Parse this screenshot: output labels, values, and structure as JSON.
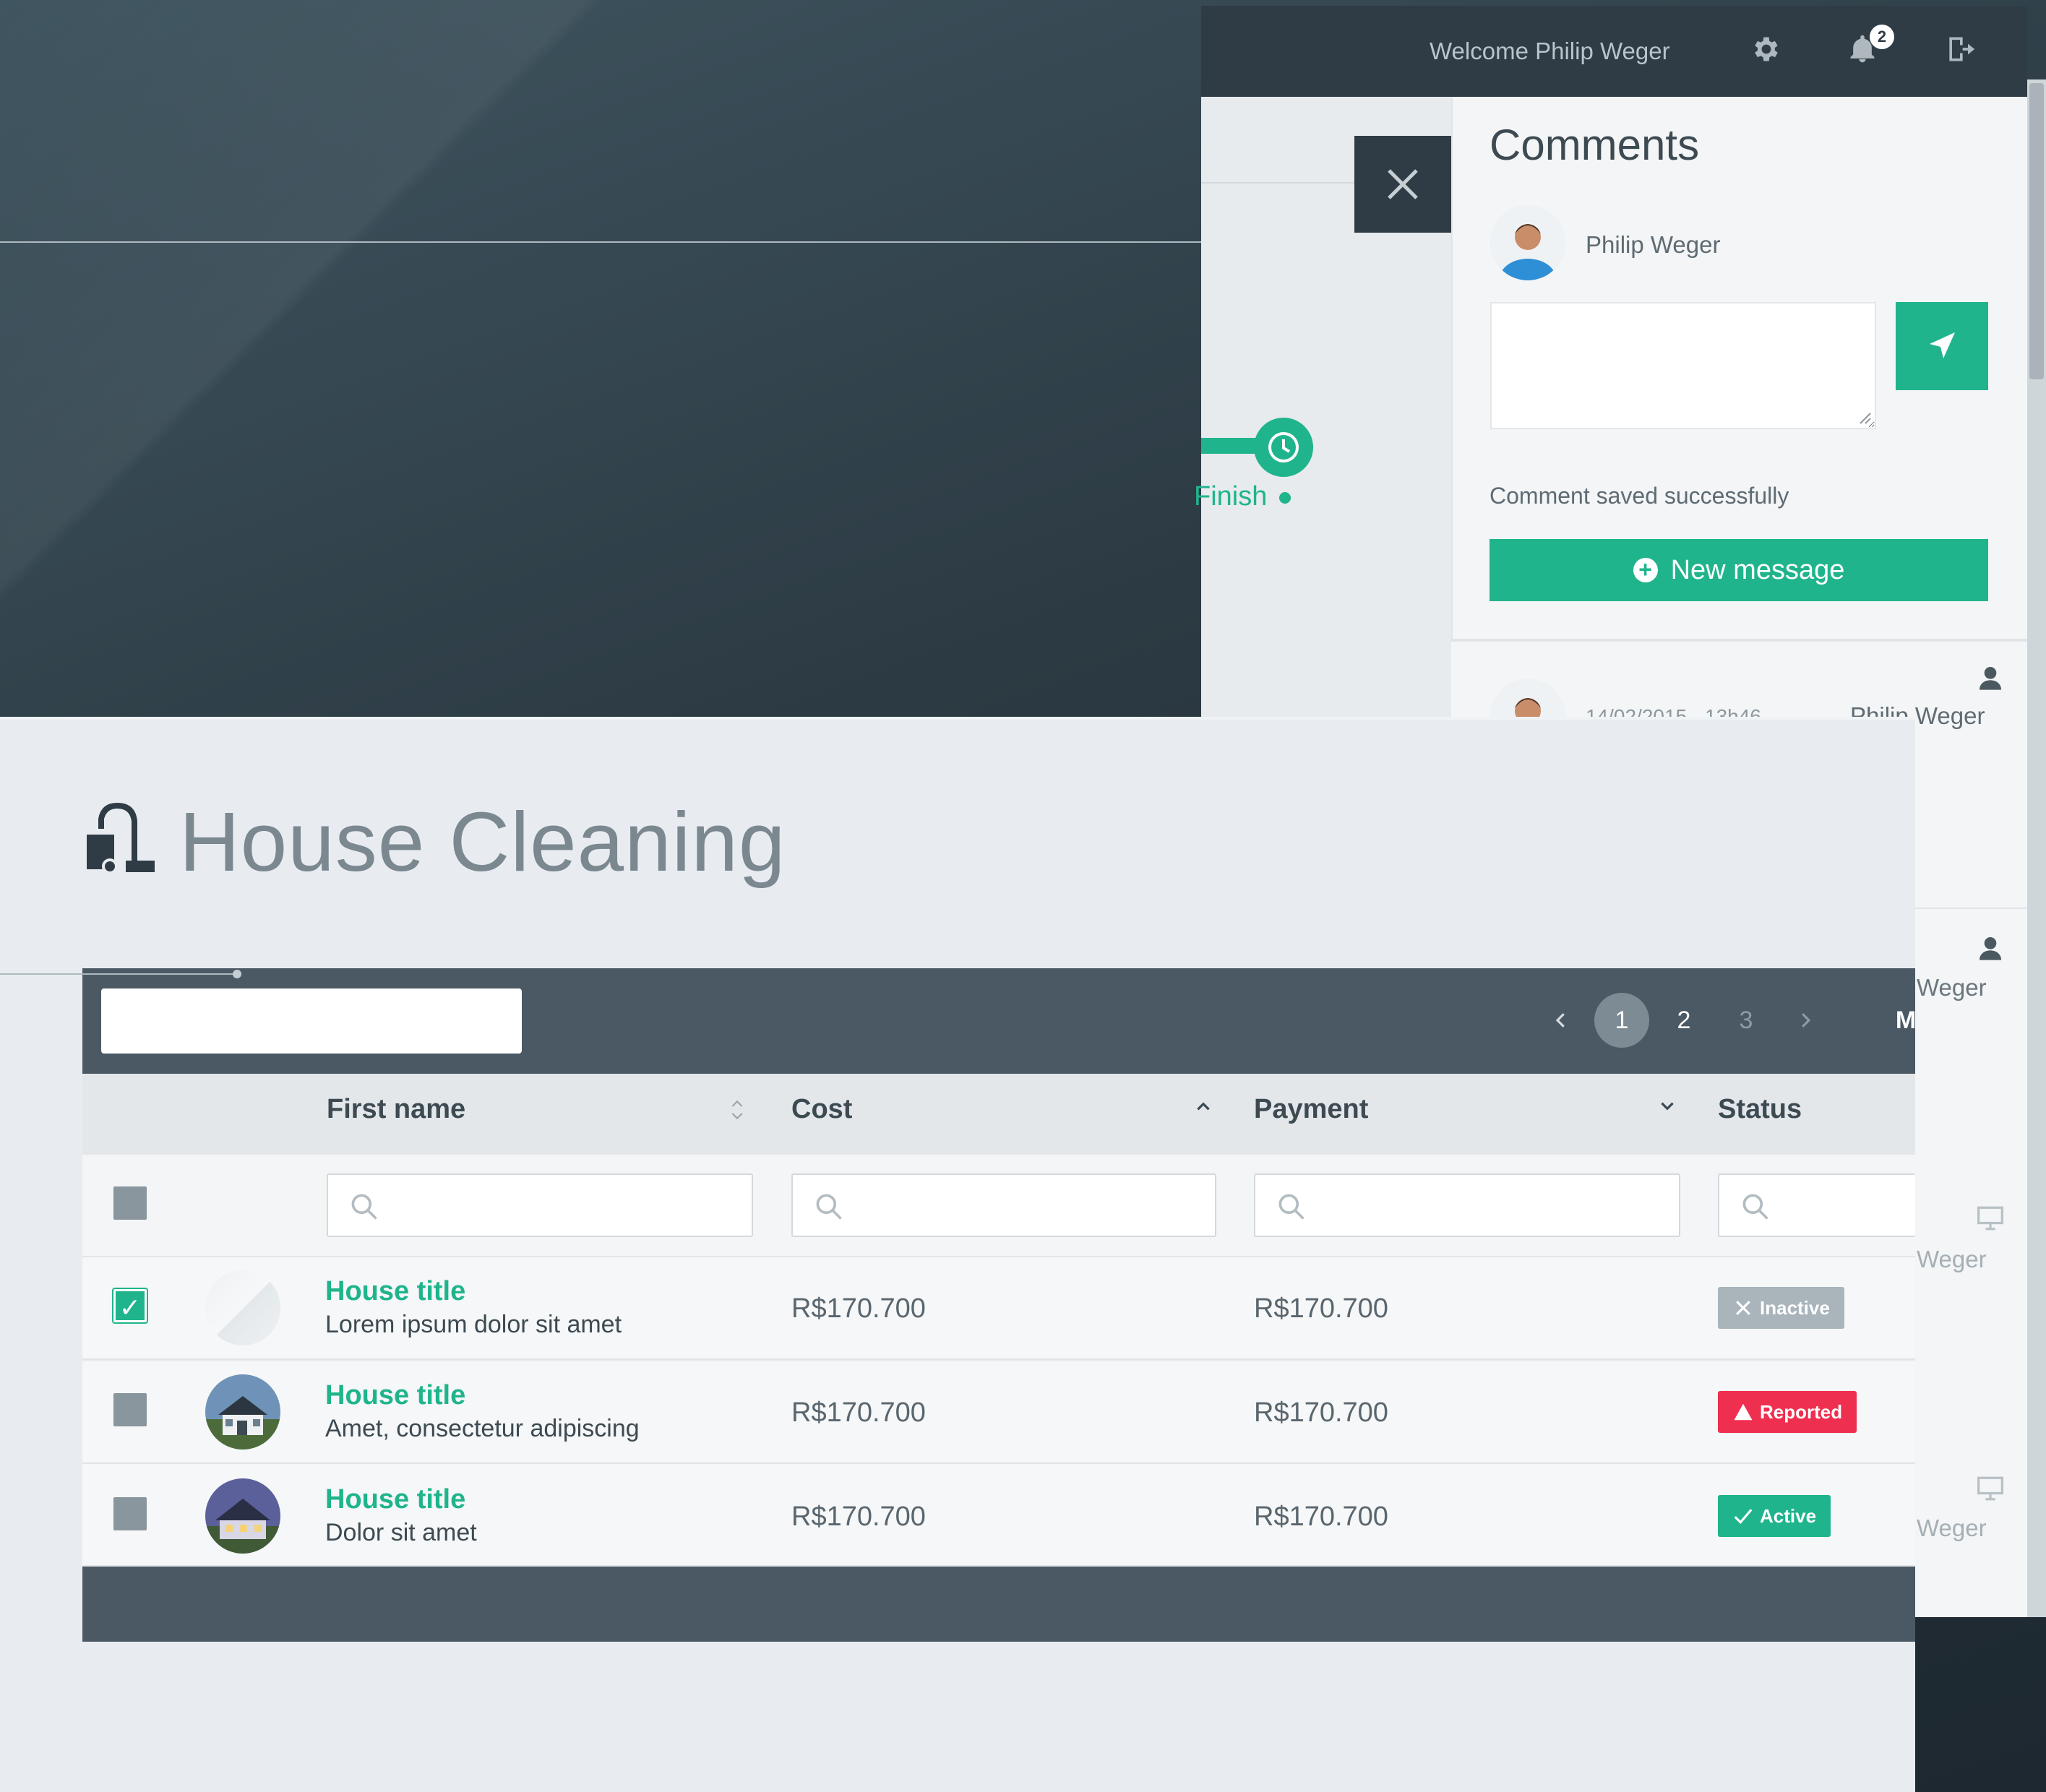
{
  "topbar": {
    "welcome": "Welcome Philip Weger",
    "notification_count": "2",
    "icons": [
      "gear-icon",
      "bell-icon",
      "logout-icon"
    ]
  },
  "timeline": {
    "step_label": "Finish"
  },
  "comments": {
    "title": "Comments",
    "current_user": "Philip Weger",
    "comment_value": "",
    "saved_message": "Comment saved successfully",
    "new_message_label": "New message",
    "messages": [
      {
        "date": "14/02/2015 - 13h46",
        "author": "Philip Weger"
      },
      {
        "author": "Weger"
      },
      {
        "author": "Weger"
      },
      {
        "author": "Weger"
      }
    ]
  },
  "page": {
    "title": "House Cleaning",
    "icon": "vacuum-cleaner-icon"
  },
  "table": {
    "search_value": "",
    "pagination": {
      "pages": [
        "1",
        "2",
        "3"
      ],
      "current": "1",
      "more": "M"
    },
    "columns": [
      {
        "label": "First name",
        "sort": "both"
      },
      {
        "label": "Cost",
        "sort": "asc"
      },
      {
        "label": "Payment",
        "sort": "desc"
      },
      {
        "label": "Status",
        "sort": "none"
      }
    ],
    "rows": [
      {
        "checked": true,
        "title": "House title",
        "subtitle": "Lorem ipsum dolor sit amet",
        "cost": "R$170.700",
        "payment": "R$170.700",
        "status": "Inactive",
        "status_icon": "x-icon"
      },
      {
        "checked": false,
        "title": "House title",
        "subtitle": "Amet, consectetur adipiscing",
        "cost": "R$170.700",
        "payment": "R$170.700",
        "status": "Reported",
        "status_icon": "warning-icon"
      },
      {
        "checked": false,
        "title": "House title",
        "subtitle": "Dolor sit amet",
        "cost": "R$170.700",
        "payment": "R$170.700",
        "status": "Active",
        "status_icon": "check-icon"
      }
    ]
  },
  "colors": {
    "accent": "#1fb48c",
    "dark": "#2f3c46",
    "table_bar": "#4b5964",
    "reported": "#ee2f4f",
    "inactive": "#a9b4bb"
  }
}
